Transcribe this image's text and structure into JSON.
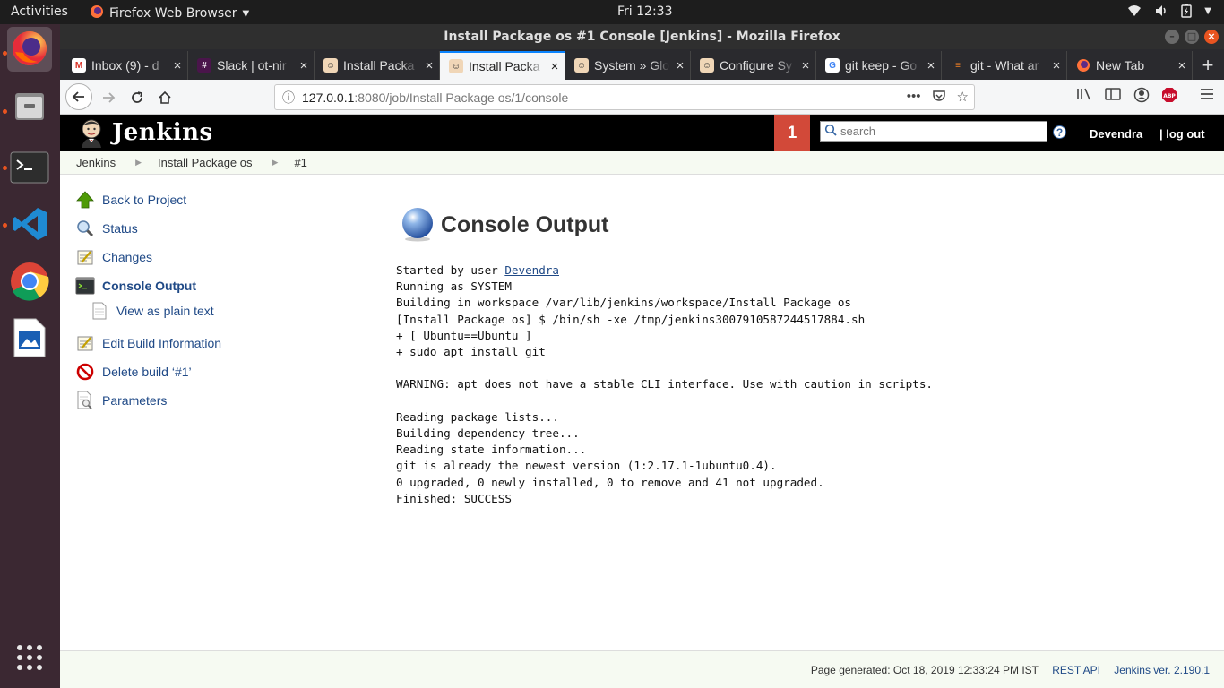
{
  "topbar": {
    "activities": "Activities",
    "app_menu": "Firefox Web Browser",
    "clock": "Fri 12:33"
  },
  "dock": {
    "items": [
      "firefox-icon",
      "files-icon",
      "terminal-icon",
      "vscode-icon",
      "chrome-icon",
      "libreoffice-draw-icon",
      "app-grid-icon"
    ]
  },
  "window": {
    "title": "Install Package os #1 Console [Jenkins] - Mozilla Firefox"
  },
  "tabs": [
    {
      "label": "Inbox (9) - d",
      "icon": "gmail-icon"
    },
    {
      "label": "Slack | ot-nir",
      "icon": "slack-icon"
    },
    {
      "label": "Install Packa",
      "icon": "jenkins-icon"
    },
    {
      "label": "Install Packa",
      "icon": "jenkins-icon",
      "active": true
    },
    {
      "label": "System » Glo",
      "icon": "jenkins-icon"
    },
    {
      "label": "Configure Sy",
      "icon": "jenkins-icon"
    },
    {
      "label": "git keep - Go",
      "icon": "google-icon"
    },
    {
      "label": "git - What ar",
      "icon": "stackoverflow-icon"
    },
    {
      "label": "New Tab",
      "icon": "firefox-icon"
    }
  ],
  "urlbar": {
    "host": "127.0.0.1",
    "path": ":8080/job/Install Package os/1/console"
  },
  "jenkins": {
    "brand": "Jenkins",
    "notification_count": "1",
    "search_placeholder": "search",
    "user": "Devendra",
    "logout": "| log out"
  },
  "breadcrumb": [
    "Jenkins",
    "Install Package os",
    "#1"
  ],
  "side_panel": [
    {
      "label": "Back to Project",
      "icon": "up-arrow-icon"
    },
    {
      "label": "Status",
      "icon": "magnifier-icon"
    },
    {
      "label": "Changes",
      "icon": "notepad-icon"
    },
    {
      "label": "Console Output",
      "icon": "terminal-icon",
      "current": true
    },
    {
      "label": "View as plain text",
      "icon": "document-icon",
      "sub": true
    },
    {
      "label": "Edit Build Information",
      "icon": "notepad-icon"
    },
    {
      "label": "Delete build ‘#1’",
      "icon": "no-entry-icon"
    },
    {
      "label": "Parameters",
      "icon": "document-search-icon"
    }
  ],
  "main": {
    "title": "Console Output",
    "console_prefix": "Started by user ",
    "console_user": "Devendra",
    "console_lines": [
      "Running as SYSTEM",
      "Building in workspace /var/lib/jenkins/workspace/Install Package os",
      "[Install Package os] $ /bin/sh -xe /tmp/jenkins3007910587244517884.sh",
      "+ [ Ubuntu==Ubuntu ]",
      "+ sudo apt install git",
      "",
      "WARNING: apt does not have a stable CLI interface. Use with caution in scripts.",
      "",
      "Reading package lists...",
      "Building dependency tree...",
      "Reading state information...",
      "git is already the newest version (1:2.17.1-1ubuntu0.4).",
      "0 upgraded, 0 newly installed, 0 to remove and 41 not upgraded.",
      "Finished: SUCCESS"
    ]
  },
  "footer": {
    "generated": "Page generated: Oct 18, 2019 12:33:24 PM IST",
    "rest_api": "REST API",
    "version": "Jenkins ver. 2.190.1"
  },
  "colors": {
    "jenkins_header": "#000000",
    "notification": "#d24939",
    "link": "#204a87",
    "dock": "#3b2832",
    "ubuntu_orange": "#e95420"
  }
}
